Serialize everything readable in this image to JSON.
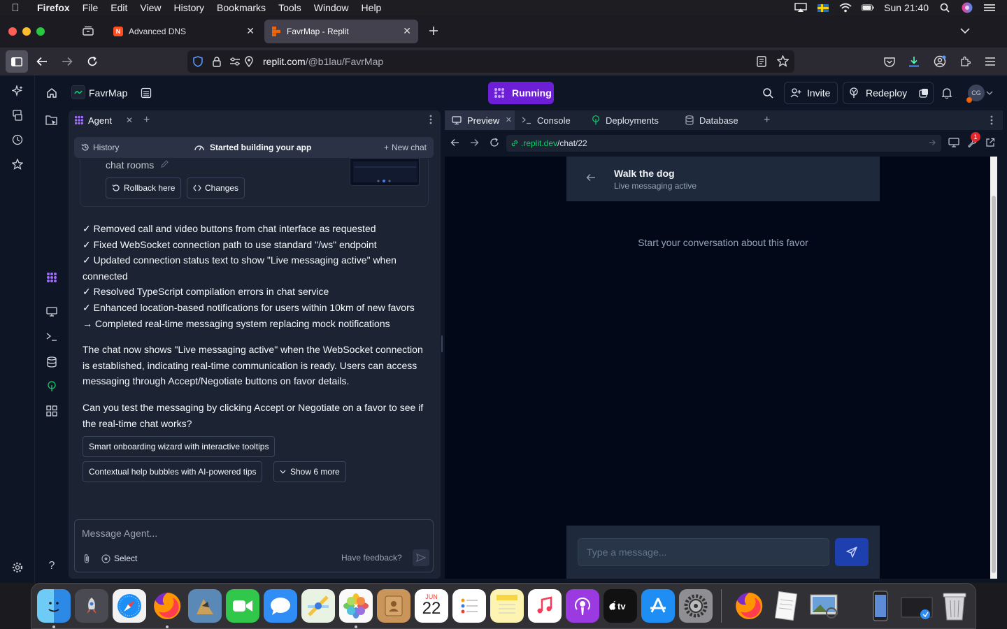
{
  "menubar": {
    "app": "Firefox",
    "items": [
      "File",
      "Edit",
      "View",
      "History",
      "Bookmarks",
      "Tools",
      "Window",
      "Help"
    ],
    "clock": "Sun 21:40"
  },
  "tabs": [
    {
      "title": "Advanced DNS"
    },
    {
      "title": "FavrMap - Replit"
    }
  ],
  "urlbar": {
    "host": "replit.com",
    "path": "/@b1lau/FavrMap"
  },
  "replit": {
    "project_name": "FavrMap",
    "run_label": "Running",
    "invite_label": "Invite",
    "redeploy_label": "Redeploy",
    "avatar_initials": "CG"
  },
  "agent": {
    "tab_label": "Agent",
    "history_label": "History",
    "status_label": "Started building your app",
    "new_chat_label": "New chat",
    "partial_line": "chat rooms",
    "rollback_label": "Rollback here",
    "changes_label": "Changes",
    "changes": [
      "✓ Removed call and video buttons from chat interface as requested",
      "✓ Fixed WebSocket connection path to use standard \"/ws\" endpoint",
      "✓ Updated connection status text to show \"Live messaging active\" when connected",
      "✓ Resolved TypeScript compilation errors in chat service",
      "✓ Enhanced location-based notifications for users within 10km of new favors",
      "→ Completed real-time messaging system replacing mock notifications"
    ],
    "paragraph1": "The chat now shows \"Live messaging active\" when the WebSocket connection is established, indicating real-time communication is ready. Users can access messaging through Accept/Negotiate buttons on favor details.",
    "paragraph2": "Can you test the messaging by clicking Accept or Negotiate on a favor to see if the real-time chat works?",
    "suggestions": [
      "Smart onboarding wizard with interactive tooltips",
      "Contextual help bubbles with AI-powered tips"
    ],
    "show_more_label": "Show 6 more",
    "input_placeholder": "Message Agent...",
    "select_label": "Select",
    "feedback_label": "Have feedback?"
  },
  "workspace_tabs": [
    "Preview",
    "Console",
    "Deployments",
    "Database"
  ],
  "preview": {
    "url_host": ".replit.dev",
    "url_path": "/chat/22",
    "chat_title": "Walk the dog",
    "chat_status": "Live messaging active",
    "empty_text": "Start your conversation about this favor",
    "message_placeholder": "Type a message...",
    "badge_count": "1"
  },
  "dock": {
    "calendar_month": "JUN",
    "calendar_day": "22"
  },
  "colors": {
    "run_button": "#6d1fd8",
    "preview_bg": "#020817",
    "send_button": "#1e40af",
    "accent_green": "#0cce6b"
  }
}
